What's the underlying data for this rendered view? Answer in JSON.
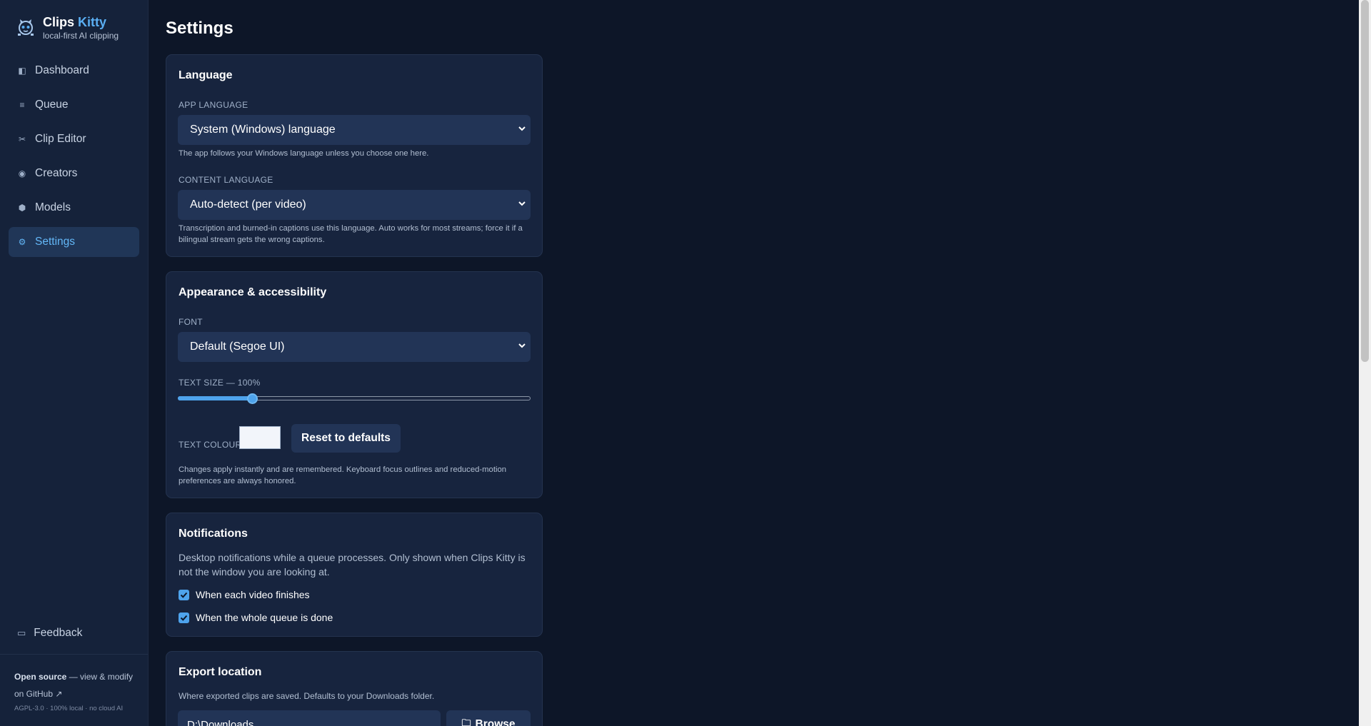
{
  "app": {
    "name_part1": "Clips",
    "name_part2": "Kitty",
    "tagline": "local-first AI clipping"
  },
  "sidebar": {
    "items": [
      {
        "label": "Dashboard",
        "icon": "dashboard-icon"
      },
      {
        "label": "Queue",
        "icon": "list-icon"
      },
      {
        "label": "Clip Editor",
        "icon": "scissors-icon"
      },
      {
        "label": "Creators",
        "icon": "target-icon"
      },
      {
        "label": "Models",
        "icon": "hexagon-icon"
      },
      {
        "label": "Settings",
        "icon": "gear-icon",
        "active": true
      }
    ],
    "feedback_label": "Feedback",
    "footer": {
      "open_source": "Open source",
      "open_source_rest": " — view & modify",
      "github_link": "on GitHub ↗",
      "legal": "AGPL-3.0 · 100% local · no cloud AI"
    }
  },
  "page": {
    "title": "Settings"
  },
  "language_card": {
    "title": "Language",
    "app_language_label": "APP LANGUAGE",
    "app_language_value": "System (Windows) language",
    "app_language_hint": "The app follows your Windows language unless you choose one here.",
    "content_language_label": "CONTENT LANGUAGE",
    "content_language_value": "Auto-detect (per video)",
    "content_language_hint": "Transcription and burned-in captions use this language. Auto works for most streams; force it if a bilingual stream gets the wrong captions."
  },
  "appearance_card": {
    "title": "Appearance & accessibility",
    "font_label": "FONT",
    "font_value": "Default (Segoe UI)",
    "text_size_label": "TEXT SIZE — 100%",
    "text_size_fraction": 0.21,
    "text_colour_label": "TEXT COLOUR",
    "text_colour_value": "#f2f5fa",
    "reset_button": "Reset to defaults",
    "hint": "Changes apply instantly and are remembered. Keyboard focus outlines and reduced-motion preferences are always honored."
  },
  "notifications_card": {
    "title": "Notifications",
    "description": "Desktop notifications while a queue processes. Only shown when Clips Kitty is not the window you are looking at.",
    "options": [
      {
        "label": "When each video finishes",
        "checked": true
      },
      {
        "label": "When the whole queue is done",
        "checked": true
      }
    ]
  },
  "export_card": {
    "title": "Export location",
    "description": "Where exported clips are saved. Defaults to your Downloads folder.",
    "path_value": "D:\\Downloads",
    "browse_button": "Browse",
    "browse_icon": "folder-icon"
  },
  "colors": {
    "accent": "#5aaef2",
    "background": "#0d1628",
    "sidebar": "#15223a",
    "card": "#17243e"
  }
}
